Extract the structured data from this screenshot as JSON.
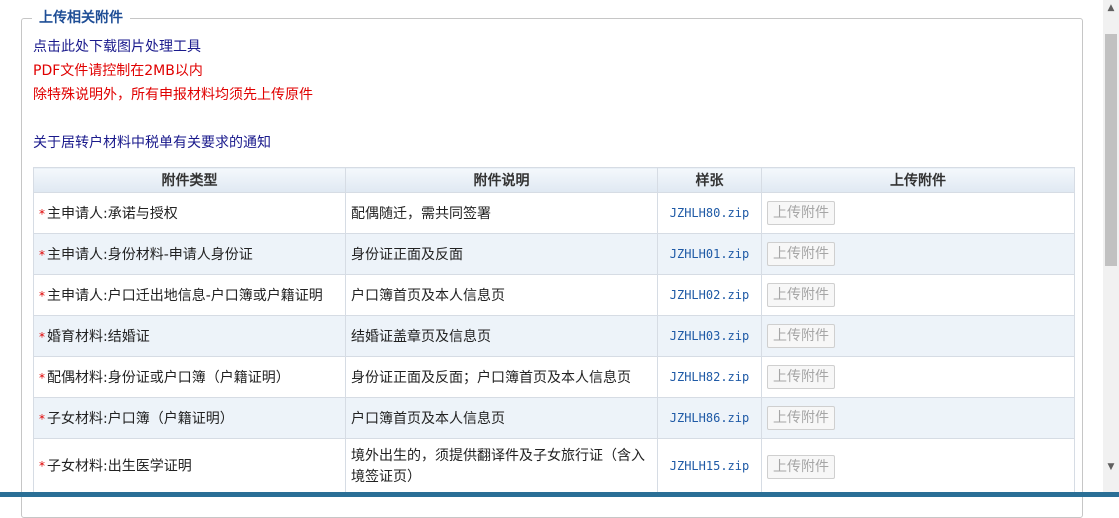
{
  "section": {
    "title": "上传相关附件"
  },
  "notes": {
    "download_tool": "点击此处下载图片处理工具",
    "pdf_limit": "PDF文件请控制在2MB以内",
    "original_required": "除特殊说明外，所有申报材料均须先上传原件",
    "tax_notice": "关于居转户材料中税单有关要求的通知"
  },
  "table": {
    "headers": [
      "附件类型",
      "附件说明",
      "样张",
      "上传附件"
    ],
    "required_mark": "*",
    "upload_label": "上传附件",
    "rows": [
      {
        "type": "主申请人:承诺与授权",
        "desc": "配偶随迁，需共同签署",
        "sample": "JZHLH80.zip"
      },
      {
        "type": "主申请人:身份材料-申请人身份证",
        "desc": "身份证正面及反面",
        "sample": "JZHLH01.zip"
      },
      {
        "type": "主申请人:户口迁出地信息-户口簿或户籍证明",
        "desc": "户口簿首页及本人信息页",
        "sample": "JZHLH02.zip"
      },
      {
        "type": "婚育材料:结婚证",
        "desc": "结婚证盖章页及信息页",
        "sample": "JZHLH03.zip"
      },
      {
        "type": "配偶材料:身份证或户口簿（户籍证明）",
        "desc": "身份证正面及反面；户口簿首页及本人信息页",
        "sample": "JZHLH82.zip"
      },
      {
        "type": "子女材料:户口簿（户籍证明）",
        "desc": "户口簿首页及本人信息页",
        "sample": "JZHLH86.zip"
      },
      {
        "type": "子女材料:出生医学证明",
        "desc": "境外出生的，须提供翻译件及子女旅行证（含入境签证页）",
        "sample": "JZHLH15.zip"
      }
    ]
  },
  "scrollbar": {
    "up_icon": "▲",
    "down_icon": "▼"
  },
  "colors": {
    "accent": "#1f4e96",
    "warning": "#e00000",
    "link": "#1a1a8c",
    "row_alt": "#edf3f9",
    "bottom_bar": "#2a6f96"
  }
}
